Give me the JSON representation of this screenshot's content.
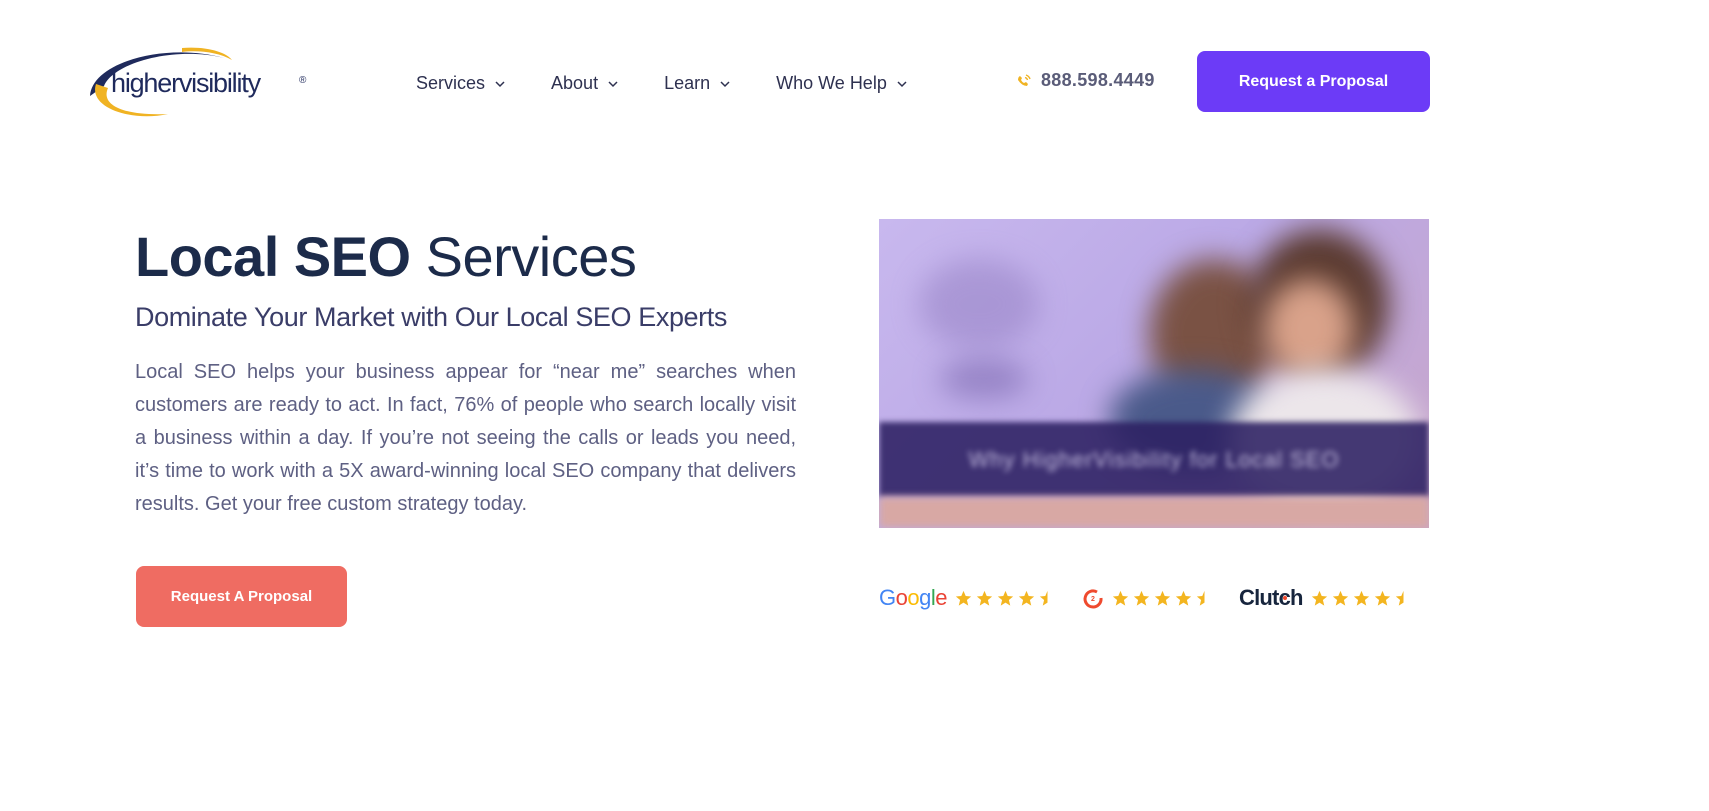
{
  "header": {
    "logo_text": "highervisibility",
    "logo_mark": "®",
    "nav": [
      {
        "label": "Services"
      },
      {
        "label": "About"
      },
      {
        "label": "Learn"
      },
      {
        "label": "Who We Help"
      }
    ],
    "phone": "888.598.4449",
    "cta_label": "Request a Proposal"
  },
  "hero": {
    "title_bold": "Local SEO",
    "title_light": "Services",
    "subtitle": "Dominate Your Market with Our Local SEO Experts",
    "body": "Local SEO helps your business appear for “near me” searches when customers are ready to act. In fact, 76% of people who search locally visit a business within a day. If you’re not seeing the calls or leads you need, it’s time to work with a 5X award-winning local SEO company that delivers results. Get your free custom strategy today.",
    "cta_label": "Request A Proposal"
  },
  "video": {
    "caption": "Why HigherVisibility for Local SEO"
  },
  "reviews": [
    {
      "brand": "Google",
      "rating": 4.5
    },
    {
      "brand": "G2",
      "rating": 4.5
    },
    {
      "brand": "Clutch",
      "rating": 4.5
    }
  ],
  "colors": {
    "primary": "#6c3bf7",
    "accent": "#ef6c62",
    "heading": "#1c2b4a",
    "star": "#f3b520",
    "logo_gold": "#f0b323",
    "logo_navy": "#1f2a5c"
  },
  "icons": {
    "phone": "phone-ringing-icon",
    "chevron": "chevron-down-icon",
    "star": "star-icon"
  }
}
